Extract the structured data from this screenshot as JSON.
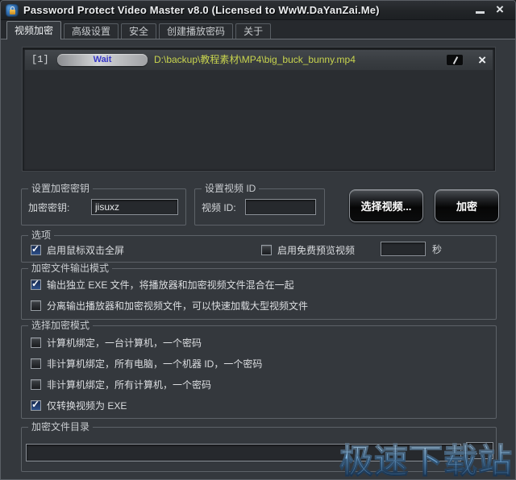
{
  "window": {
    "title": "Password Protect Video Master v8.0 (Licensed to WwW.DaYanZai.Me)",
    "close_label": "×"
  },
  "tabs": [
    {
      "label": "视频加密",
      "active": true
    },
    {
      "label": "高级设置",
      "active": false
    },
    {
      "label": "安全",
      "active": false
    },
    {
      "label": "创建播放密码",
      "active": false
    },
    {
      "label": "关于",
      "active": false
    }
  ],
  "file_list": {
    "rows": [
      {
        "index": "[1]",
        "status": "Wait",
        "path": "D:\\backup\\教程素材\\MP4\\big_buck_bunny.mp4"
      }
    ],
    "row_close_label": "×"
  },
  "key_group": {
    "title": "设置加密密钥",
    "label": "加密密钥:",
    "value": "jisuxz"
  },
  "id_group": {
    "title": "设置视频 ID",
    "label": "视频 ID:",
    "value": ""
  },
  "actions": {
    "select_video": "选择视频...",
    "encrypt": "加密"
  },
  "options_group": {
    "title": "选项",
    "double_click_fullscreen": {
      "label": "启用鼠标双击全屏",
      "checked": true
    },
    "free_preview": {
      "label": "启用免费预览视频",
      "checked": false,
      "seconds_value": "",
      "unit": "秒"
    }
  },
  "output_group": {
    "title": "加密文件输出模式",
    "items": [
      {
        "label": "输出独立 EXE 文件，将播放器和加密视频文件混合在一起",
        "checked": true
      },
      {
        "label": "分离输出播放器和加密视频文件，可以快速加载大型视频文件",
        "checked": false
      }
    ]
  },
  "mode_group": {
    "title": "选择加密模式",
    "items": [
      {
        "label": "计算机绑定，一台计算机，一个密码",
        "checked": false
      },
      {
        "label": "非计算机绑定，所有电脑，一个机器 ID，一个密码",
        "checked": false
      },
      {
        "label": "非计算机绑定，所有计算机，一个密码",
        "checked": false
      },
      {
        "label": "仅转换视频为 EXE",
        "checked": true
      }
    ]
  },
  "dir_group": {
    "title": "加密文件目录",
    "value": ""
  },
  "watermark": "极速下载站",
  "colors": {
    "status_blue": "#3838c8",
    "path_yellow": "#c8d44e",
    "watermark_blue": "#6fa9da"
  }
}
